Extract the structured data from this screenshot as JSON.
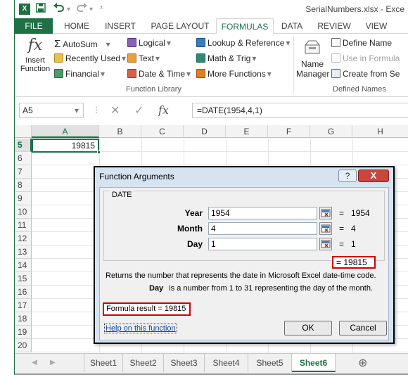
{
  "window": {
    "app_logo": "X",
    "title": "SerialNumbers.xlsx - Exce",
    "qat_icons": [
      "save-icon",
      "undo-icon",
      "redo-icon",
      "customize-icon"
    ]
  },
  "tabs": [
    "FILE",
    "HOME",
    "INSERT",
    "PAGE LAYOUT",
    "FORMULAS",
    "DATA",
    "REVIEW",
    "VIEW"
  ],
  "active_tab": "FORMULAS",
  "ribbon": {
    "insert_function": {
      "icon": "fx",
      "line1": "Insert",
      "line2": "Function"
    },
    "autosum": "AutoSum",
    "recently_used": "Recently Used",
    "financial": "Financial",
    "logical": "Logical",
    "text": "Text",
    "date_time": "Date & Time",
    "lookup_reference": "Lookup & Reference",
    "math_trig": "Math & Trig",
    "more_functions": "More Functions",
    "group_function_library": "Function Library",
    "name_manager": {
      "line1": "Name",
      "line2": "Manager"
    },
    "define_name": "Define Name",
    "use_in_formula": "Use in Formula",
    "create_from_selection": "Create from Se",
    "group_defined_names": "Defined Names",
    "dropdown_arrow": "▾"
  },
  "formula_bar": {
    "name_box": "A5",
    "fx_label": "fx",
    "formula": "=DATE(1954,4,1)"
  },
  "grid": {
    "columns": [
      "A",
      "B",
      "C",
      "D",
      "E",
      "F",
      "G",
      "H"
    ],
    "rows": [
      "5",
      "6",
      "7",
      "8",
      "9",
      "10",
      "11",
      "12",
      "13",
      "14",
      "15",
      "16",
      "17",
      "18",
      "19",
      "20"
    ],
    "active_cell_value": "19815"
  },
  "dialog": {
    "title": "Function Arguments",
    "help_button": "?",
    "close_button": "X",
    "function_name": "DATE",
    "args": [
      {
        "label": "Year",
        "value": "1954",
        "eq": "=",
        "result": "1954"
      },
      {
        "label": "Month",
        "value": "4",
        "eq": "=",
        "result": "4"
      },
      {
        "label": "Day",
        "value": "1",
        "eq": "=",
        "result": "1"
      }
    ],
    "result": "=  19815",
    "description": "Returns the number that represents the date in Microsoft Excel date-time code.",
    "param_name": "Day",
    "param_desc": "is a number from 1 to 31 representing the day of the month.",
    "formula_result": "Formula result =   19815",
    "help_link": "Help on this function",
    "ok": "OK",
    "cancel": "Cancel"
  },
  "sheets": [
    "Sheet1",
    "Sheet2",
    "Sheet3",
    "Sheet4",
    "Sheet5",
    "Sheet6"
  ],
  "active_sheet": "Sheet6",
  "sheet_nav": {
    "prev": "◀",
    "next": "▶",
    "add": "⊕"
  },
  "colors": {
    "accent": "#1e7145",
    "highlight_border": "#d00000",
    "dialog_frame": "#d6e4f2",
    "link": "#0645ad"
  }
}
